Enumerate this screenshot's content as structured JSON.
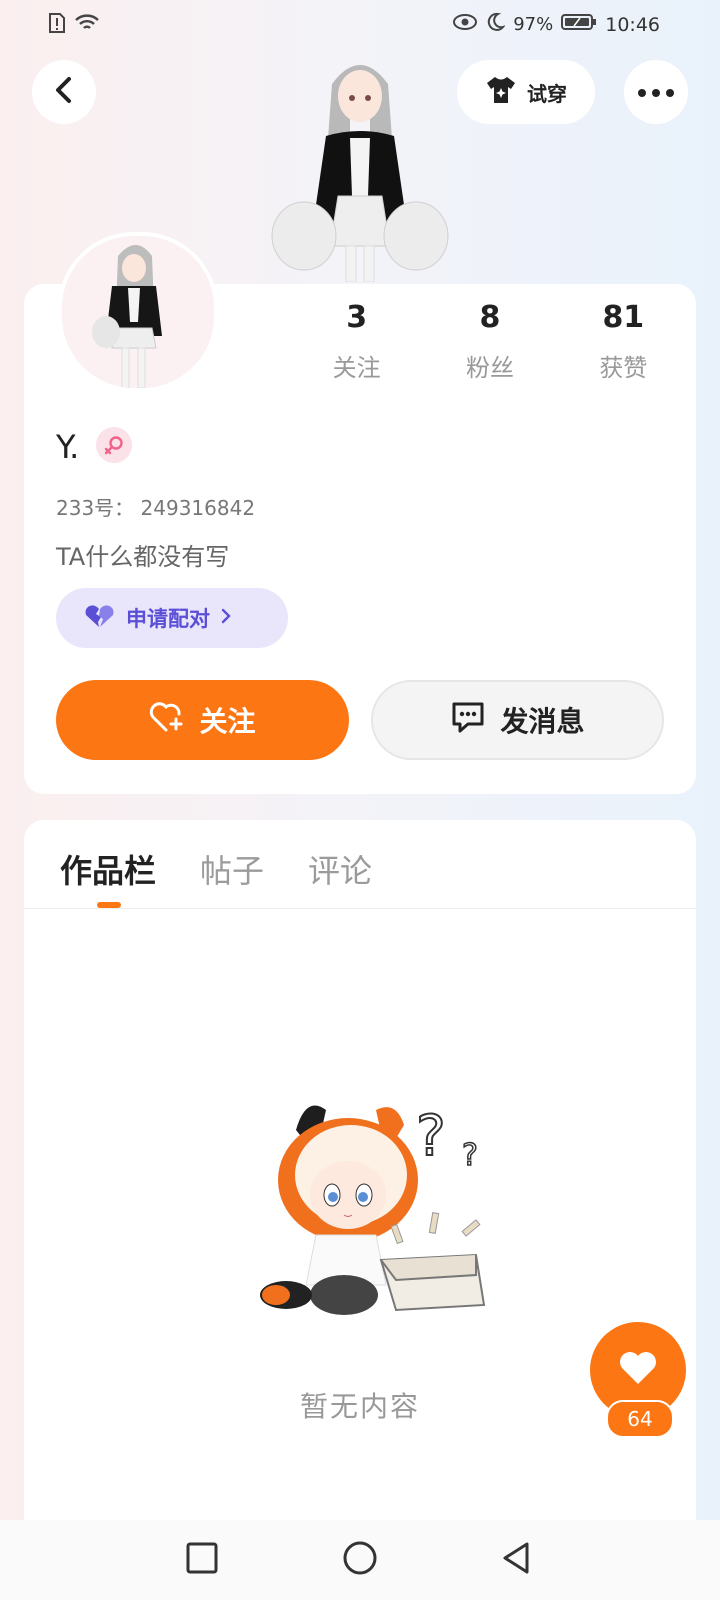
{
  "status_bar": {
    "battery": "97%",
    "time": "10:46",
    "icons": [
      "sim-alert-icon",
      "wifi-icon",
      "eye-icon",
      "moon-icon",
      "battery-icon"
    ]
  },
  "top_bar": {
    "try_on_label": "试穿",
    "icons": [
      "back-arrow-icon",
      "tshirt-icon",
      "more-icon"
    ]
  },
  "profile": {
    "username": "Y.",
    "gender": "female",
    "id_line": "233号： 249316842",
    "bio": "TA什么都没有写",
    "stats": [
      {
        "value": "3",
        "label": "关注"
      },
      {
        "value": "8",
        "label": "粉丝"
      },
      {
        "value": "81",
        "label": "获赞"
      }
    ],
    "pair_label": "申请配对"
  },
  "actions": {
    "follow_label": "关注",
    "message_label": "发消息"
  },
  "tabs": [
    {
      "label": "作品栏",
      "active": true
    },
    {
      "label": "帖子",
      "active": false
    },
    {
      "label": "评论",
      "active": false
    }
  ],
  "empty_state": {
    "text": "暂无内容"
  },
  "like_fab": {
    "count": "64"
  },
  "colors": {
    "accent": "#fd7614",
    "pair_bg": "#e9e6fb",
    "pair_text": "#5b4fd6",
    "gender_female": "#f1628a"
  }
}
